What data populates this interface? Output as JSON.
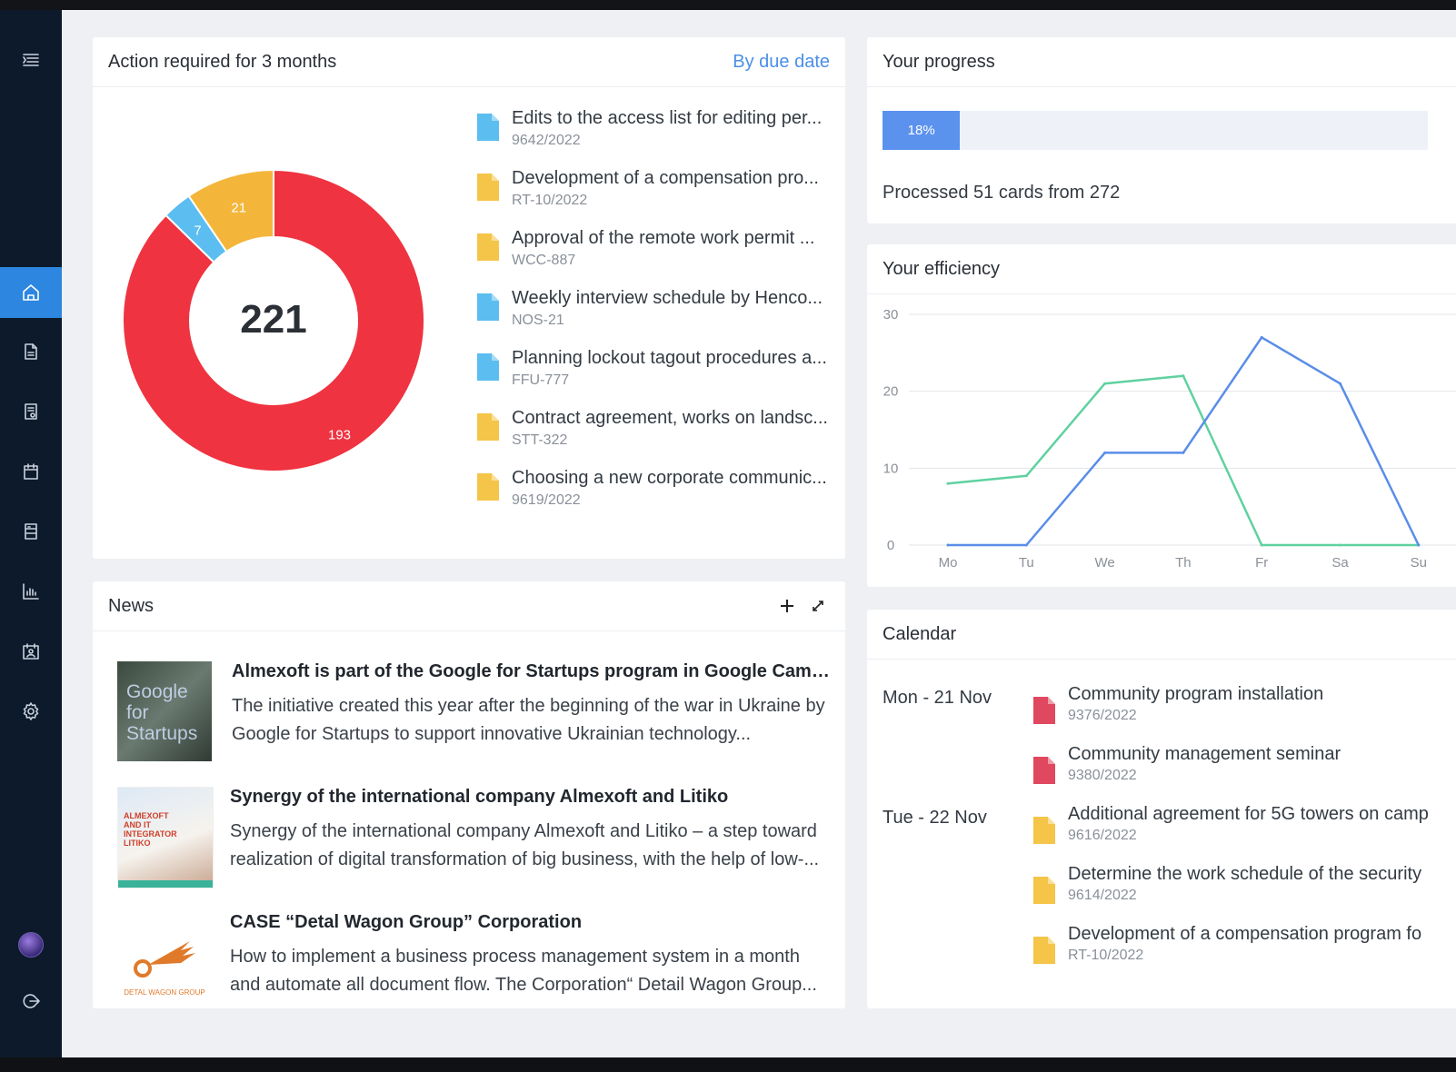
{
  "action": {
    "title": "Action required for 3 months",
    "sort_link": "By due date",
    "donut": {
      "total": "221",
      "segments": [
        {
          "label": "193",
          "value": 193,
          "color": "#ef3340"
        },
        {
          "label": "7",
          "value": 7,
          "color": "#5bbdf0"
        },
        {
          "label": "21",
          "value": 21,
          "color": "#f4b63a"
        }
      ]
    },
    "items": [
      {
        "title": "Edits to the access list for editing per...",
        "number": "9642/2022",
        "color": "#5bbdf0"
      },
      {
        "title": "Development of a compensation pro...",
        "number": "RT-10/2022",
        "color": "#f4c548"
      },
      {
        "title": "Approval of the remote work permit ...",
        "number": "WCC-887",
        "color": "#f4c548"
      },
      {
        "title": "Weekly interview schedule by Henco...",
        "number": "NOS-21",
        "color": "#5bbdf0"
      },
      {
        "title": "Planning lockout tagout procedures a...",
        "number": "FFU-777",
        "color": "#5bbdf0"
      },
      {
        "title": "Contract agreement, works on landsc...",
        "number": "STT-322",
        "color": "#f4c548"
      },
      {
        "title": "Choosing a new corporate communic...",
        "number": "9619/2022",
        "color": "#f4c548"
      }
    ]
  },
  "news": {
    "title": "News",
    "items": [
      {
        "title": "Almexoft is part of the Google for Startups program in Google Campu...",
        "body": "The initiative created this year after the beginning of the war in Ukraine by Google for Startups to support innovative Ukrainian technology...",
        "thumb_text": "Google for Startups"
      },
      {
        "title": "Synergy of the international company Almexoft and Litiko",
        "body": "Synergy of the international company Almexoft and Litiko – a step toward realization of digital transformation of big business, with the help of low-...",
        "thumb_text": "ALMEXOFT AND IT INTEGRATOR LITIKO"
      },
      {
        "title": "CASE “Detal Wagon Group” Corporation",
        "body": "How to implement a business process management system in a month and automate all document flow.  The Corporation“ Detail Wagon Group...",
        "thumb_text": "DETAL WAGON GROUP"
      }
    ]
  },
  "progress": {
    "title": "Your progress",
    "percent_label": "18%",
    "fraction": 0.18,
    "summary": "Processed 51 cards from 272"
  },
  "efficiency": {
    "title": "Your efficiency"
  },
  "chart_data": {
    "type": "line",
    "categories": [
      "Mo",
      "Tu",
      "We",
      "Th",
      "Fr",
      "Sa",
      "Su"
    ],
    "ylim": [
      0,
      30
    ],
    "yticks": [
      0,
      10,
      20,
      30
    ],
    "grid": true,
    "series": [
      {
        "color": "#5fd1a0",
        "values": [
          8,
          9,
          21,
          22,
          0,
          0,
          0
        ]
      },
      {
        "color": "#5a8de8",
        "values": [
          0,
          0,
          12,
          12,
          27,
          21,
          0
        ]
      }
    ]
  },
  "calendar": {
    "title": "Calendar",
    "days": [
      {
        "label": "Mon - 21 Nov",
        "events": [
          {
            "title": "Community program installation",
            "number": "9376/2022",
            "color": "#e04860"
          },
          {
            "title": "Community management seminar",
            "number": "9380/2022",
            "color": "#e04860"
          }
        ]
      },
      {
        "label": "Tue - 22 Nov",
        "events": [
          {
            "title": "Additional agreement for 5G towers on camp",
            "number": "9616/2022",
            "color": "#f4c548"
          },
          {
            "title": "Determine the work schedule of the security",
            "number": "9614/2022",
            "color": "#f4c548"
          },
          {
            "title": "Development of a compensation program fo",
            "number": "RT-10/2022",
            "color": "#f4c548"
          }
        ]
      }
    ]
  },
  "sidebar": {
    "items": [
      "menu-icon",
      "home-icon",
      "document-icon",
      "report-icon",
      "calendar-icon",
      "list-icon",
      "analytics-icon",
      "contacts-icon",
      "settings-icon",
      "avatar",
      "logout-icon"
    ]
  }
}
